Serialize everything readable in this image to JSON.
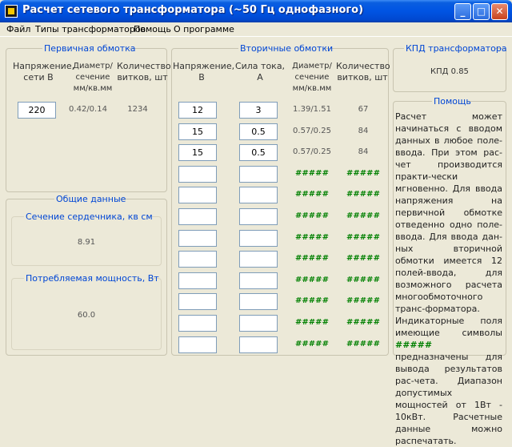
{
  "window": {
    "title": "Расчет сетевого трансформатора (~50 Гц однофазного)",
    "min_glyph": "_",
    "max_glyph": "□",
    "close_glyph": "✕"
  },
  "menu": [
    "Файл",
    "Типы трансформаторов",
    "Помощь",
    "О программе"
  ],
  "primary": {
    "title": "Первичная обмотка",
    "col_voltage": "Напряжение,\nсети В",
    "col_diameter": "Диаметр/\nсечение\nмм/кв.мм",
    "col_turns": "Количество\nвитков, шт",
    "voltage": "220",
    "diameter": "0.42/0.14",
    "turns": "1234"
  },
  "general": {
    "title": "Общие данные",
    "core_title": "Сечение сердечника, кв см",
    "core_value": "8.91",
    "power_title": "Потребляемая мощность, Вт",
    "power_value": "60.0"
  },
  "secondary": {
    "title": "Вторичные обмотки",
    "col_voltage": "Напряжение,\nВ",
    "col_current": "Сила тока,\nА",
    "col_diameter": "Диаметр/\nсечение\nмм/кв.мм",
    "col_turns": "Количество\nвитков, шт",
    "rows": [
      {
        "voltage": "12",
        "current": "3",
        "diameter": "1.39/1.51",
        "turns": "67"
      },
      {
        "voltage": "15",
        "current": "0.5",
        "diameter": "0.57/0.25",
        "turns": "84"
      },
      {
        "voltage": "15",
        "current": "0.5",
        "diameter": "0.57/0.25",
        "turns": "84"
      },
      {
        "voltage": "",
        "current": "",
        "diameter": "#####",
        "turns": "#####"
      },
      {
        "voltage": "",
        "current": "",
        "diameter": "#####",
        "turns": "#####"
      },
      {
        "voltage": "",
        "current": "",
        "diameter": "#####",
        "turns": "#####"
      },
      {
        "voltage": "",
        "current": "",
        "diameter": "#####",
        "turns": "#####"
      },
      {
        "voltage": "",
        "current": "",
        "diameter": "#####",
        "turns": "#####"
      },
      {
        "voltage": "",
        "current": "",
        "diameter": "#####",
        "turns": "#####"
      },
      {
        "voltage": "",
        "current": "",
        "diameter": "#####",
        "turns": "#####"
      },
      {
        "voltage": "",
        "current": "",
        "diameter": "#####",
        "turns": "#####"
      },
      {
        "voltage": "",
        "current": "",
        "diameter": "#####",
        "turns": "#####"
      }
    ]
  },
  "efficiency": {
    "title": "КПД трансформатора",
    "value": "КПД 0.85"
  },
  "help": {
    "title": "Помощь",
    "text_before": "Расчет может начинаться с вводом данных в любое поле-ввода. При этом рас-чет производится практи-чески мгновенно. Для ввода напряжения на первичной обмотке отведенно одно поле-ввода. Для ввода дан-ных вторичной обмотки имеется 12 полей-ввода, для возможного расчета многообмоточного транс-форматора. Индикаторные поля имеющие символы ",
    "text_hash": "#####",
    "text_after": " предназначены для вывода результатов рас-чета. Диапазон допустимых мощностей от 1Вт - 10кВт. Расчетные данные можно распечатать."
  },
  "colors": {
    "titlebar": "#0054e3",
    "group_title": "#0046d5",
    "placeholder": "#008000",
    "background": "#ece9d8"
  }
}
